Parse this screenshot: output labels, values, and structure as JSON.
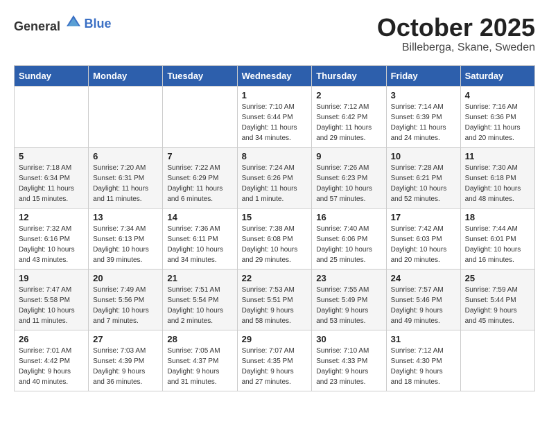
{
  "header": {
    "logo_general": "General",
    "logo_blue": "Blue",
    "month": "October 2025",
    "location": "Billeberga, Skane, Sweden"
  },
  "weekdays": [
    "Sunday",
    "Monday",
    "Tuesday",
    "Wednesday",
    "Thursday",
    "Friday",
    "Saturday"
  ],
  "weeks": [
    [
      {
        "day": "",
        "info": ""
      },
      {
        "day": "",
        "info": ""
      },
      {
        "day": "",
        "info": ""
      },
      {
        "day": "1",
        "info": "Sunrise: 7:10 AM\nSunset: 6:44 PM\nDaylight: 11 hours\nand 34 minutes."
      },
      {
        "day": "2",
        "info": "Sunrise: 7:12 AM\nSunset: 6:42 PM\nDaylight: 11 hours\nand 29 minutes."
      },
      {
        "day": "3",
        "info": "Sunrise: 7:14 AM\nSunset: 6:39 PM\nDaylight: 11 hours\nand 24 minutes."
      },
      {
        "day": "4",
        "info": "Sunrise: 7:16 AM\nSunset: 6:36 PM\nDaylight: 11 hours\nand 20 minutes."
      }
    ],
    [
      {
        "day": "5",
        "info": "Sunrise: 7:18 AM\nSunset: 6:34 PM\nDaylight: 11 hours\nand 15 minutes."
      },
      {
        "day": "6",
        "info": "Sunrise: 7:20 AM\nSunset: 6:31 PM\nDaylight: 11 hours\nand 11 minutes."
      },
      {
        "day": "7",
        "info": "Sunrise: 7:22 AM\nSunset: 6:29 PM\nDaylight: 11 hours\nand 6 minutes."
      },
      {
        "day": "8",
        "info": "Sunrise: 7:24 AM\nSunset: 6:26 PM\nDaylight: 11 hours\nand 1 minute."
      },
      {
        "day": "9",
        "info": "Sunrise: 7:26 AM\nSunset: 6:23 PM\nDaylight: 10 hours\nand 57 minutes."
      },
      {
        "day": "10",
        "info": "Sunrise: 7:28 AM\nSunset: 6:21 PM\nDaylight: 10 hours\nand 52 minutes."
      },
      {
        "day": "11",
        "info": "Sunrise: 7:30 AM\nSunset: 6:18 PM\nDaylight: 10 hours\nand 48 minutes."
      }
    ],
    [
      {
        "day": "12",
        "info": "Sunrise: 7:32 AM\nSunset: 6:16 PM\nDaylight: 10 hours\nand 43 minutes."
      },
      {
        "day": "13",
        "info": "Sunrise: 7:34 AM\nSunset: 6:13 PM\nDaylight: 10 hours\nand 39 minutes."
      },
      {
        "day": "14",
        "info": "Sunrise: 7:36 AM\nSunset: 6:11 PM\nDaylight: 10 hours\nand 34 minutes."
      },
      {
        "day": "15",
        "info": "Sunrise: 7:38 AM\nSunset: 6:08 PM\nDaylight: 10 hours\nand 29 minutes."
      },
      {
        "day": "16",
        "info": "Sunrise: 7:40 AM\nSunset: 6:06 PM\nDaylight: 10 hours\nand 25 minutes."
      },
      {
        "day": "17",
        "info": "Sunrise: 7:42 AM\nSunset: 6:03 PM\nDaylight: 10 hours\nand 20 minutes."
      },
      {
        "day": "18",
        "info": "Sunrise: 7:44 AM\nSunset: 6:01 PM\nDaylight: 10 hours\nand 16 minutes."
      }
    ],
    [
      {
        "day": "19",
        "info": "Sunrise: 7:47 AM\nSunset: 5:58 PM\nDaylight: 10 hours\nand 11 minutes."
      },
      {
        "day": "20",
        "info": "Sunrise: 7:49 AM\nSunset: 5:56 PM\nDaylight: 10 hours\nand 7 minutes."
      },
      {
        "day": "21",
        "info": "Sunrise: 7:51 AM\nSunset: 5:54 PM\nDaylight: 10 hours\nand 2 minutes."
      },
      {
        "day": "22",
        "info": "Sunrise: 7:53 AM\nSunset: 5:51 PM\nDaylight: 9 hours\nand 58 minutes."
      },
      {
        "day": "23",
        "info": "Sunrise: 7:55 AM\nSunset: 5:49 PM\nDaylight: 9 hours\nand 53 minutes."
      },
      {
        "day": "24",
        "info": "Sunrise: 7:57 AM\nSunset: 5:46 PM\nDaylight: 9 hours\nand 49 minutes."
      },
      {
        "day": "25",
        "info": "Sunrise: 7:59 AM\nSunset: 5:44 PM\nDaylight: 9 hours\nand 45 minutes."
      }
    ],
    [
      {
        "day": "26",
        "info": "Sunrise: 7:01 AM\nSunset: 4:42 PM\nDaylight: 9 hours\nand 40 minutes."
      },
      {
        "day": "27",
        "info": "Sunrise: 7:03 AM\nSunset: 4:39 PM\nDaylight: 9 hours\nand 36 minutes."
      },
      {
        "day": "28",
        "info": "Sunrise: 7:05 AM\nSunset: 4:37 PM\nDaylight: 9 hours\nand 31 minutes."
      },
      {
        "day": "29",
        "info": "Sunrise: 7:07 AM\nSunset: 4:35 PM\nDaylight: 9 hours\nand 27 minutes."
      },
      {
        "day": "30",
        "info": "Sunrise: 7:10 AM\nSunset: 4:33 PM\nDaylight: 9 hours\nand 23 minutes."
      },
      {
        "day": "31",
        "info": "Sunrise: 7:12 AM\nSunset: 4:30 PM\nDaylight: 9 hours\nand 18 minutes."
      },
      {
        "day": "",
        "info": ""
      }
    ]
  ]
}
